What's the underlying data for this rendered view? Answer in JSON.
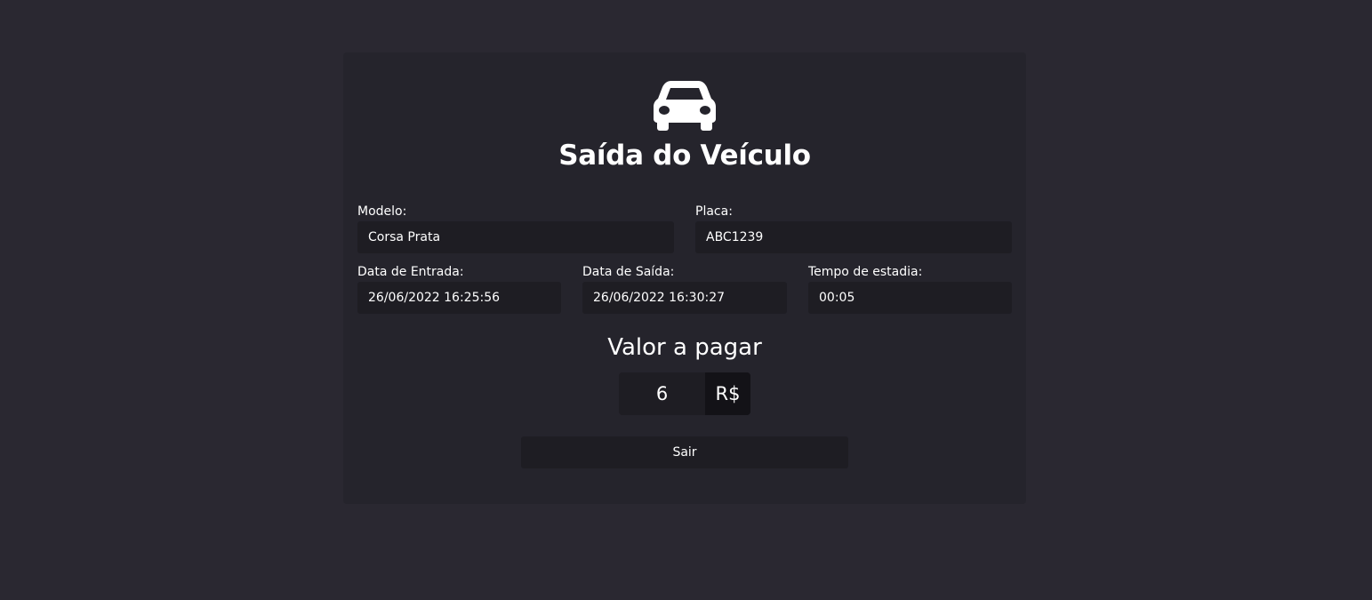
{
  "page": {
    "title": "Saída do Veículo",
    "icon": "car-icon"
  },
  "fields": {
    "modelo": {
      "label": "Modelo:",
      "value": "Corsa Prata"
    },
    "placa": {
      "label": "Placa:",
      "value": "ABC1239"
    },
    "data_entrada": {
      "label": "Data de Entrada:",
      "value": "26/06/2022 16:25:56"
    },
    "data_saida": {
      "label": "Data de Saída:",
      "value": "26/06/2022 16:30:27"
    },
    "tempo_estadia": {
      "label": "Tempo de estadia:",
      "value": "00:05"
    }
  },
  "valor": {
    "title": "Valor a pagar",
    "value": "6",
    "currency": "R$"
  },
  "actions": {
    "sair_label": "Sair"
  },
  "colors": {
    "background": "#2a2831",
    "card": "#25242c",
    "input": "#1e1d23",
    "addon": "#131217",
    "text": "#ffffff"
  }
}
